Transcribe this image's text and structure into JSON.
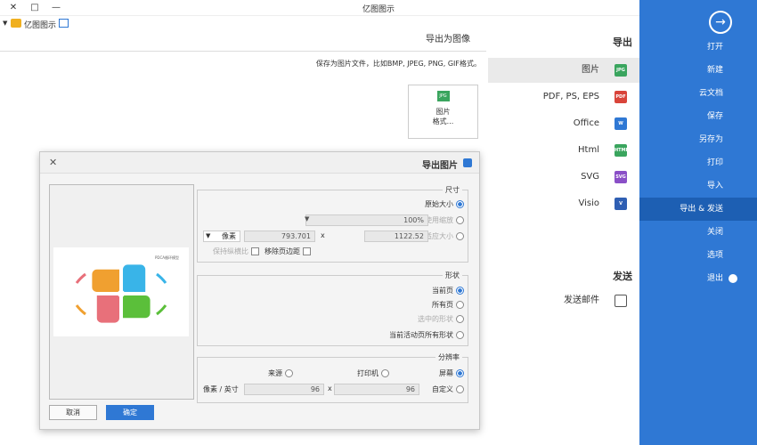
{
  "window": {
    "title": "亿图图示",
    "minimize": "—",
    "maximize": "□",
    "close": "✕"
  },
  "toolbar": {
    "app_label": "亿图图示",
    "collapse": "▸"
  },
  "sidebar": {
    "back_icon": "arrow-right",
    "items": [
      {
        "label": "打开"
      },
      {
        "label": "新建"
      },
      {
        "label": "云文档"
      },
      {
        "label": "保存"
      },
      {
        "label": "另存为"
      },
      {
        "label": "打印"
      },
      {
        "label": "导入"
      },
      {
        "label": "导出 & 发送"
      },
      {
        "label": "关闭"
      },
      {
        "label": "选项"
      },
      {
        "label": "退出"
      }
    ]
  },
  "middle": {
    "export_heading": "导出",
    "formats": [
      {
        "label": "图片",
        "icon": "JPG",
        "color": "#3aa55e"
      },
      {
        "label": "PDF, PS, EPS",
        "icon": "PDF",
        "color": "#d9443a"
      },
      {
        "label": "Office",
        "icon": "W",
        "color": "#2f78d4"
      },
      {
        "label": "Html",
        "icon": "HTML",
        "color": "#3aa55e"
      },
      {
        "label": "SVG",
        "icon": "SVG",
        "color": "#8a4fc7"
      },
      {
        "label": "Visio",
        "icon": "V",
        "color": "#2f5fb3"
      }
    ],
    "send_heading": "发送",
    "send_item": "发送邮件"
  },
  "content": {
    "title": "导出为图像",
    "desc": "保存为图片文件，比如BMP, JPEG, PNG, GIF格式。",
    "card_label_1": "图片",
    "card_label_2": "格式...",
    "card_icon": "JPG"
  },
  "dialog": {
    "title": "导出图片",
    "close": "✕",
    "size_group": {
      "title": "尺寸",
      "original": "原始大小",
      "use_zoom": "使用缩放",
      "zoom_value": "100%",
      "fit_size": "适应大小",
      "width": "1122.52",
      "times": "x",
      "height": "793.701",
      "unit": "像素",
      "remove_margin": "移除页边距",
      "keep_ratio": "保持纵横比"
    },
    "shape_group": {
      "title": "形状",
      "current_page": "当前页",
      "all_pages": "所有页",
      "selected_shapes": "选中的形状",
      "active_page_shapes": "当前活动页所有形状"
    },
    "resolution_group": {
      "title": "分辨率",
      "screen": "屏幕",
      "printer": "打印机",
      "source": "来源",
      "custom": "自定义",
      "dpi_x": "96",
      "times": "x",
      "dpi_y": "96",
      "unit": "像素 / 英寸"
    },
    "ok": "确定",
    "cancel": "取消",
    "preview_caption": "PDCA循环模型"
  }
}
